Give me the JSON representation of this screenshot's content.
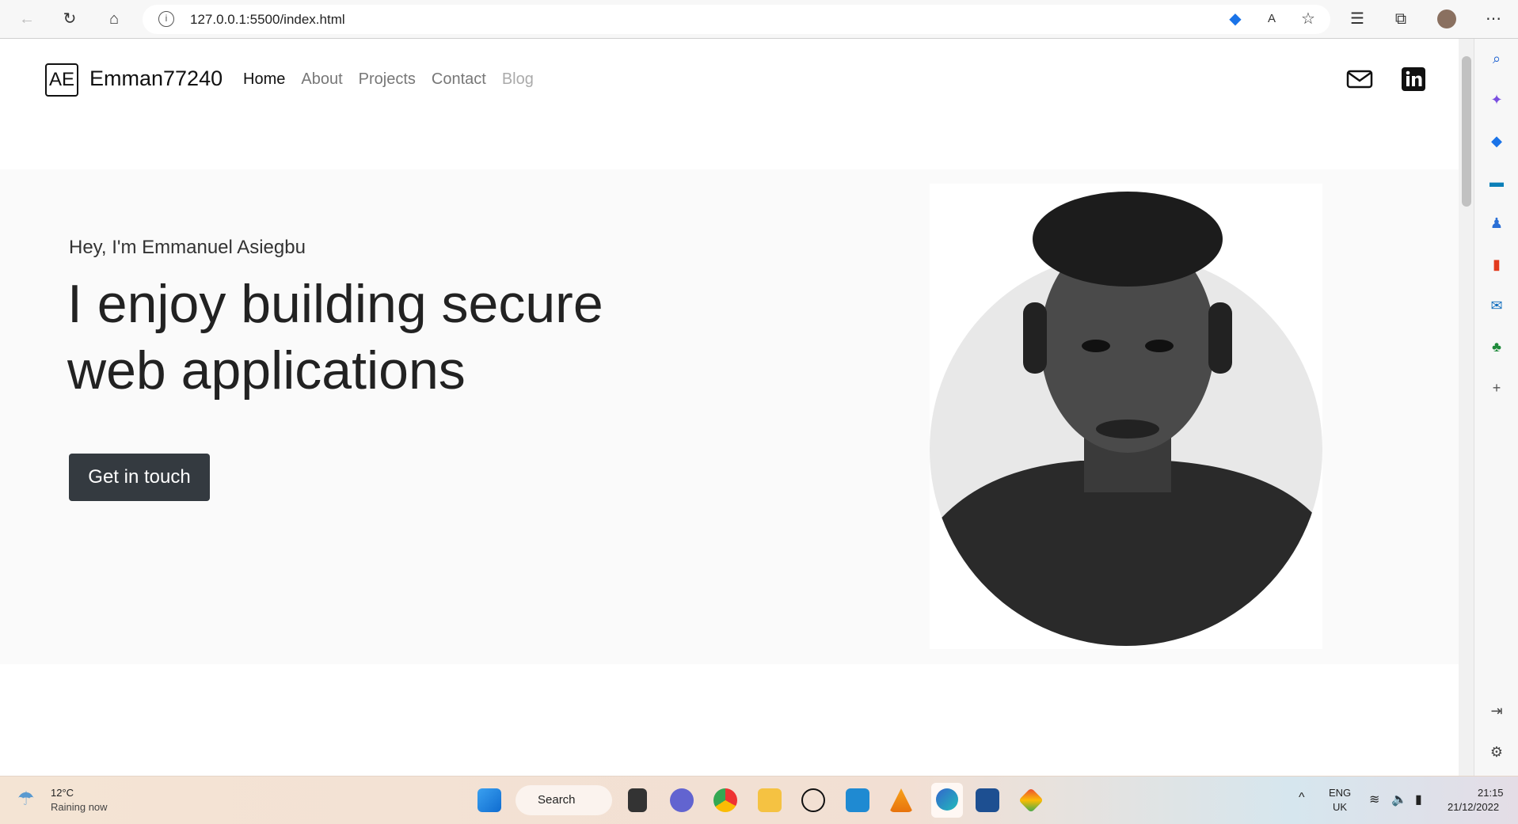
{
  "browser": {
    "url": "127.0.0.1:5500/index.html"
  },
  "nav": {
    "logo_text": "AE",
    "brand": "Emman77240",
    "items": [
      {
        "label": "Home"
      },
      {
        "label": "About"
      },
      {
        "label": "Projects"
      },
      {
        "label": "Contact"
      },
      {
        "label": "Blog"
      }
    ]
  },
  "hero": {
    "greeting": "Hey, I'm Emmanuel Asiegbu",
    "headline": "I enjoy building secure web applications",
    "cta": "Get in touch"
  },
  "taskbar": {
    "temp": "12°C",
    "weather": "Raining now",
    "search": "Search",
    "lang": "ENG",
    "region": "UK",
    "time": "21:15",
    "date": "21/12/2022"
  },
  "colors": {
    "button": "#343a40",
    "hero_bg": "#fafafa"
  }
}
